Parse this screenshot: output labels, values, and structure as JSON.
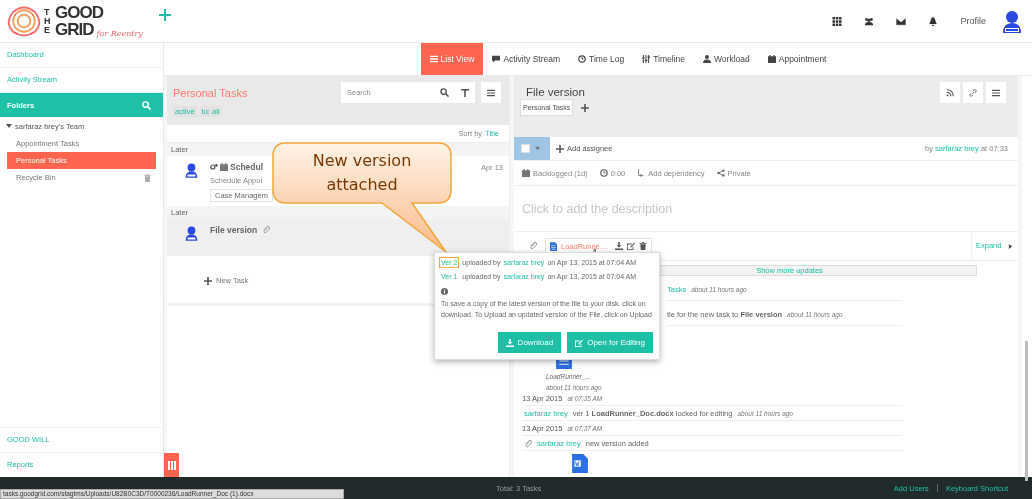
{
  "header": {
    "logo": {
      "prefix": "THE",
      "line1": "GOOD",
      "line2": "GRID",
      "tagline": "for Reentry"
    },
    "profile_label": "Profile"
  },
  "sidebar": {
    "items": [
      "Dashboard",
      "Activity Stream"
    ],
    "folders_label": "Folders",
    "team": {
      "label": "sarfaraz brey's Team",
      "expanded": true,
      "children": [
        {
          "label": "Appointment Tasks",
          "selected": false
        },
        {
          "label": "Personal Tasks",
          "selected": true
        },
        {
          "label": "Recycle Bin",
          "selected": false,
          "kind": "trash"
        }
      ]
    },
    "bottom_items": [
      "GOOD WILL",
      "Reports"
    ]
  },
  "view_tabs": [
    {
      "label": "List View",
      "selected": true,
      "kind": "list"
    },
    {
      "label": "Activity Stream",
      "selected": false,
      "kind": "comment"
    },
    {
      "label": "Time Log",
      "selected": false,
      "kind": "clock"
    },
    {
      "label": "Timeline",
      "selected": false,
      "kind": "timeline"
    },
    {
      "label": "Workload",
      "selected": false,
      "kind": "user"
    },
    {
      "label": "Appointment",
      "selected": false,
      "kind": "calendar"
    }
  ],
  "task_list": {
    "title": "Personal Tasks",
    "search": {
      "placeholder": "Search"
    },
    "filters": [
      "active",
      "to: all"
    ],
    "sort_label": "Sort by",
    "sort_value": "Title",
    "groups": [
      {
        "label": "Later",
        "tasks": [
          {
            "title": "Schedul",
            "subtitle": "Schedule Appoi",
            "tag": "Case Managem",
            "date": "Apr 13",
            "kind": "scheduled",
            "selected": false
          }
        ]
      },
      {
        "label": "Later",
        "tasks": [
          {
            "title": "File version",
            "kind": "attachment",
            "selected": true
          }
        ]
      }
    ],
    "new_task": "New Task"
  },
  "detail": {
    "title": "File version",
    "folder_tag": "Personal Tasks",
    "add_assignee": "Add assignee",
    "by_label": "by",
    "author": "sarfaraz brey",
    "time": "at 07:33",
    "meta": [
      {
        "label": "Backlogged (1d)",
        "kind": "calendar"
      },
      {
        "label": "0:00",
        "kind": "clock"
      },
      {
        "label": "Add dependency",
        "kind": "dependency"
      },
      {
        "label": "Private",
        "kind": "share"
      }
    ],
    "description_placeholder": "Click to add the description",
    "attachment": "LoadRunne…",
    "expand": "Expand",
    "show_more": "Show more updates",
    "activity": [
      {
        "kind": "partial",
        "link": "Tasks",
        "ago": "about 11 hours ago"
      },
      {
        "kind": "partial",
        "text": "tle for the new task to **File version**",
        "ago": "about 11 hours ago"
      },
      {
        "kind": "file",
        "name": "LoadRunner_...",
        "ago": "about 11 hours ago"
      },
      {
        "kind": "date",
        "date": "13 Apr 2015",
        "time": "at 07:35 AM"
      },
      {
        "kind": "event",
        "user": "sarfaraz brey",
        "text": "ver 1 **LoadRunner_Doc.docx** locked for editing",
        "ago": "about 11 hours ago"
      },
      {
        "kind": "date",
        "date": "13 Apr 2015",
        "time": "at 07:37 AM"
      },
      {
        "kind": "clip",
        "user": "sarfaraz brey",
        "text": "new version added"
      },
      {
        "kind": "doc"
      }
    ]
  },
  "popover": {
    "versions": [
      {
        "version": "Ver 2",
        "text": "uploaded by",
        "user": "sarfaraz brey",
        "when": "on Apr 13, 2015 at 07:04 AM",
        "highlighted": true
      },
      {
        "version": "Ver 1",
        "text": "uploaded by",
        "user": "sarfaraz brey",
        "when": "on Apr 13, 2015 at 07:04 AM",
        "highlighted": false
      }
    ],
    "info": "To save a copy of the latest version of the file to your disk. click on download. To Upload an updated version of the File. click on Upload",
    "buttons": [
      {
        "label": "Download",
        "kind": "download"
      },
      {
        "label": "Open for Editing",
        "kind": "edit"
      }
    ]
  },
  "callout": {
    "text": "New version attached"
  },
  "footer": {
    "total": "Total: 3 Tasks",
    "links": [
      "Add Users",
      "Keyboard Shortcut"
    ]
  },
  "status_url": "tasks.goodgrid.com/stagtms/Uploads/U82B0C3D/T0000236/LoadRunner_Doc (1).docx"
}
